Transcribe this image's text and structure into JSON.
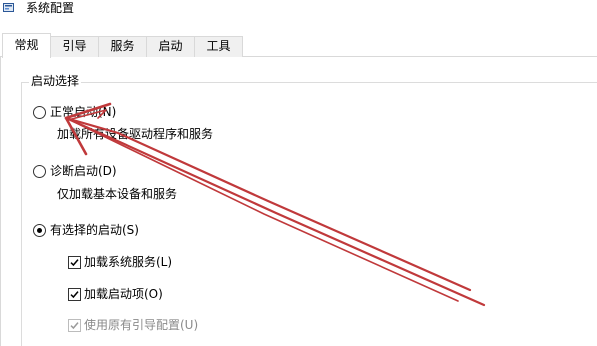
{
  "window": {
    "title": "系统配置",
    "icon": "msconfig-icon"
  },
  "tabs": [
    {
      "label": "常规",
      "active": true
    },
    {
      "label": "引导",
      "active": false
    },
    {
      "label": "服务",
      "active": false
    },
    {
      "label": "启动",
      "active": false
    },
    {
      "label": "工具",
      "active": false
    }
  ],
  "startup_selection": {
    "legend": "启动选择",
    "options": [
      {
        "label": "正常启动(N)",
        "description": "加载所有设备驱动程序和服务",
        "selected": false
      },
      {
        "label": "诊断启动(D)",
        "description": "仅加载基本设备和服务",
        "selected": false
      },
      {
        "label": "有选择的启动(S)",
        "selected": true
      }
    ],
    "selective_items": [
      {
        "label": "加载系统服务(L)",
        "checked": true,
        "enabled": true
      },
      {
        "label": "加载启动项(O)",
        "checked": true,
        "enabled": true
      },
      {
        "label": "使用原有引导配置(U)",
        "checked": true,
        "enabled": false
      }
    ]
  },
  "annotation": {
    "arrow_color": "#c0393b"
  }
}
